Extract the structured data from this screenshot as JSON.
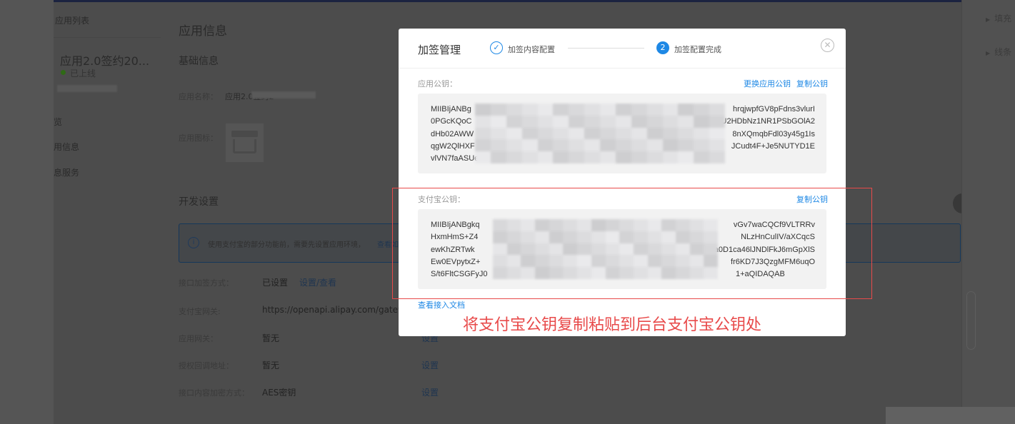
{
  "background": {
    "sidebar": {
      "back_label": "应用列表",
      "app_name": "应用2.0签约20...",
      "status": "已上线",
      "status_color": "#3c8a1e",
      "menu": [
        "览",
        "用信息",
        "息服务"
      ]
    },
    "page_title": "应用信息",
    "basic": {
      "title": "基础信息",
      "name_label": "应用名称：",
      "name_value": "应用2.0签约2",
      "icon_label": "应用图标："
    },
    "dev": {
      "title": "开发设置",
      "banner_text": "使用支付宝的部分功能前，需要先设置应用环境，",
      "banner_link": "查看如",
      "rows": [
        {
          "label": "接口加签方式：",
          "value": "已设置",
          "link": "设置/查看"
        },
        {
          "label": "支付宝网关:",
          "value": "https://openapi.alipay.com/gateway.d",
          "link": ""
        },
        {
          "label": "应用网关：",
          "value": "暂无",
          "link": "设置"
        },
        {
          "label": "授权回调地址：",
          "value": "暂无",
          "link": "设置"
        },
        {
          "label": "接口内容加密方式：",
          "value": "AES密钥",
          "link": "设置"
        }
      ]
    },
    "right_panel": [
      "填充",
      "线条"
    ]
  },
  "modal": {
    "title": "加签管理",
    "steps": [
      {
        "label": "加签内容配置",
        "state": "done"
      },
      {
        "num": "2",
        "label": "加签配置完成",
        "state": "active"
      }
    ],
    "accent": "#1e88e5",
    "app_key": {
      "label": "应用公钥：",
      "change_link": "更换应用公钥",
      "copy_link": "复制公钥",
      "lines": [
        "MIIBIjANBg",
        "0PGcKQoC",
        "dHb02AWW",
        "qgW2QlHXF",
        "vlVN7faASUe"
      ],
      "lines_right": [
        "hrqjwpfGV8pFdns3vlurI",
        "gU2HDbNz1NR1PSbGOlA2",
        "8nXQmqbFdl03y45g1Is",
        "JCudt4F+Je5NUTYD1E",
        ""
      ]
    },
    "alipay_key": {
      "label": "支付宝公钥：",
      "copy_link": "复制公钥",
      "lines": [
        "MIIBIjANBgkq",
        "HxmHmS+Z4",
        "ewKhZRTwk",
        "Ew0EVpytxZ+",
        "S/t6FltCSGFyJ0"
      ],
      "lines_right": [
        "vGv7waCQCf9VLTRRv",
        "NLzHnCulIV/aXCqcS",
        "a0D1ca46lJNDlFkJ6mGpXlS",
        "fr6KD7J3QzgMFM6uqO",
        "1+aQIDAQAB"
      ]
    },
    "doc_link": "查看接入文档"
  },
  "annotation": {
    "text": "将支付宝公钥复制粘贴到后台支付宝公钥处",
    "color": "#e84a4a"
  }
}
